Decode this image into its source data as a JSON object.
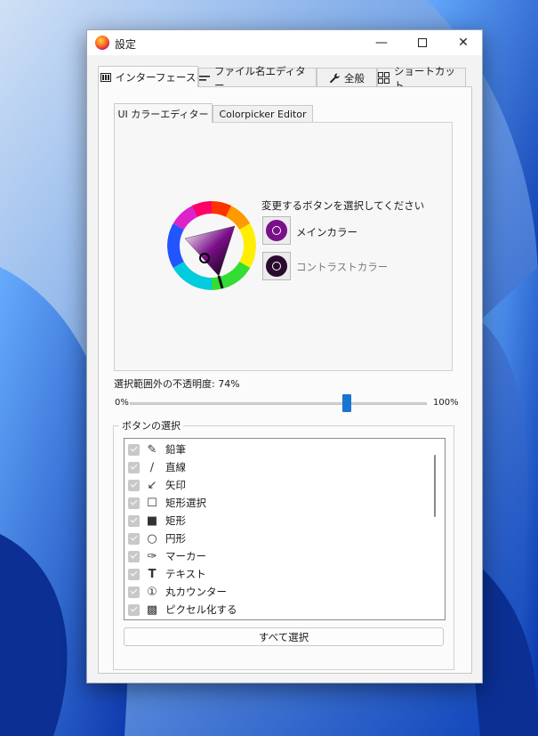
{
  "window": {
    "title": "設定"
  },
  "tabs": [
    {
      "label": "インターフェース",
      "icon": "interface-icon"
    },
    {
      "label": "ファイル名エディター",
      "icon": "filename-icon"
    },
    {
      "label": "全般",
      "icon": "wrench-icon"
    },
    {
      "label": "ショートカット",
      "icon": "grid-icon"
    }
  ],
  "subtabs": [
    {
      "label": "UI カラーエディター"
    },
    {
      "label": "Colorpicker Editor"
    }
  ],
  "color_editor": {
    "prompt": "変更するボタンを選択してください",
    "main_label": "メインカラー",
    "main_color": "#7a0f8a",
    "contrast_label": "コントラストカラー",
    "contrast_color": "#2a0a2e"
  },
  "opacity": {
    "label": "選択範囲外の不透明度: 74%",
    "min_label": "0%",
    "max_label": "100%",
    "value": 74
  },
  "buttons_group": {
    "title": "ボタンの選択",
    "items": [
      {
        "label": "鉛筆",
        "icon": "pencil-icon"
      },
      {
        "label": "直線",
        "icon": "line-icon"
      },
      {
        "label": "矢印",
        "icon": "arrow-icon"
      },
      {
        "label": "矩形選択",
        "icon": "rect-select-icon"
      },
      {
        "label": "矩形",
        "icon": "rect-filled-icon"
      },
      {
        "label": "円形",
        "icon": "circle-icon"
      },
      {
        "label": "マーカー",
        "icon": "marker-icon"
      },
      {
        "label": "テキスト",
        "icon": "text-icon"
      },
      {
        "label": "丸カウンター",
        "icon": "counter-icon"
      },
      {
        "label": "ピクセル化する",
        "icon": "pixelate-icon"
      }
    ],
    "select_all_label": "すべて選択"
  },
  "colors": {
    "accent": "#1a74d2",
    "checkbox": "#c8c8c8"
  }
}
